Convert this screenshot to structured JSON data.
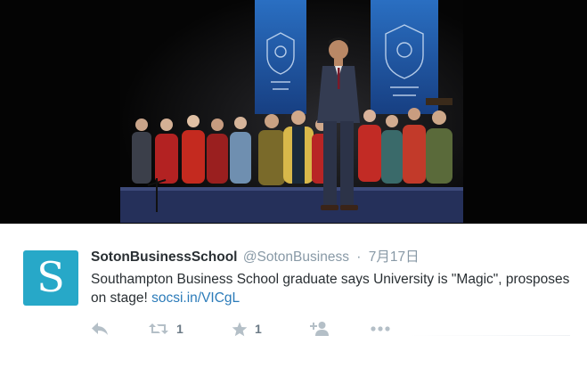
{
  "tweet": {
    "display_name": "SotonBusinessSchool",
    "handle": "@SotonBusiness",
    "separator": "·",
    "timestamp": "7月17日",
    "avatar_letter": "S",
    "text": "Southampton Business School graduate says University is \"Magic\", prosposes on stage! ",
    "link": "socsi.in/VICgL"
  },
  "actions": {
    "retweet_count": "1",
    "favorite_count": "1"
  },
  "colors": {
    "avatar_bg": "#27a8c8",
    "link": "#2b7bb9",
    "meta_gray": "#8899a6",
    "banner_blue": "#1e5aa8"
  },
  "icons": [
    "reply-icon",
    "retweet-icon",
    "star-icon",
    "follow-icon",
    "more-icon"
  ]
}
